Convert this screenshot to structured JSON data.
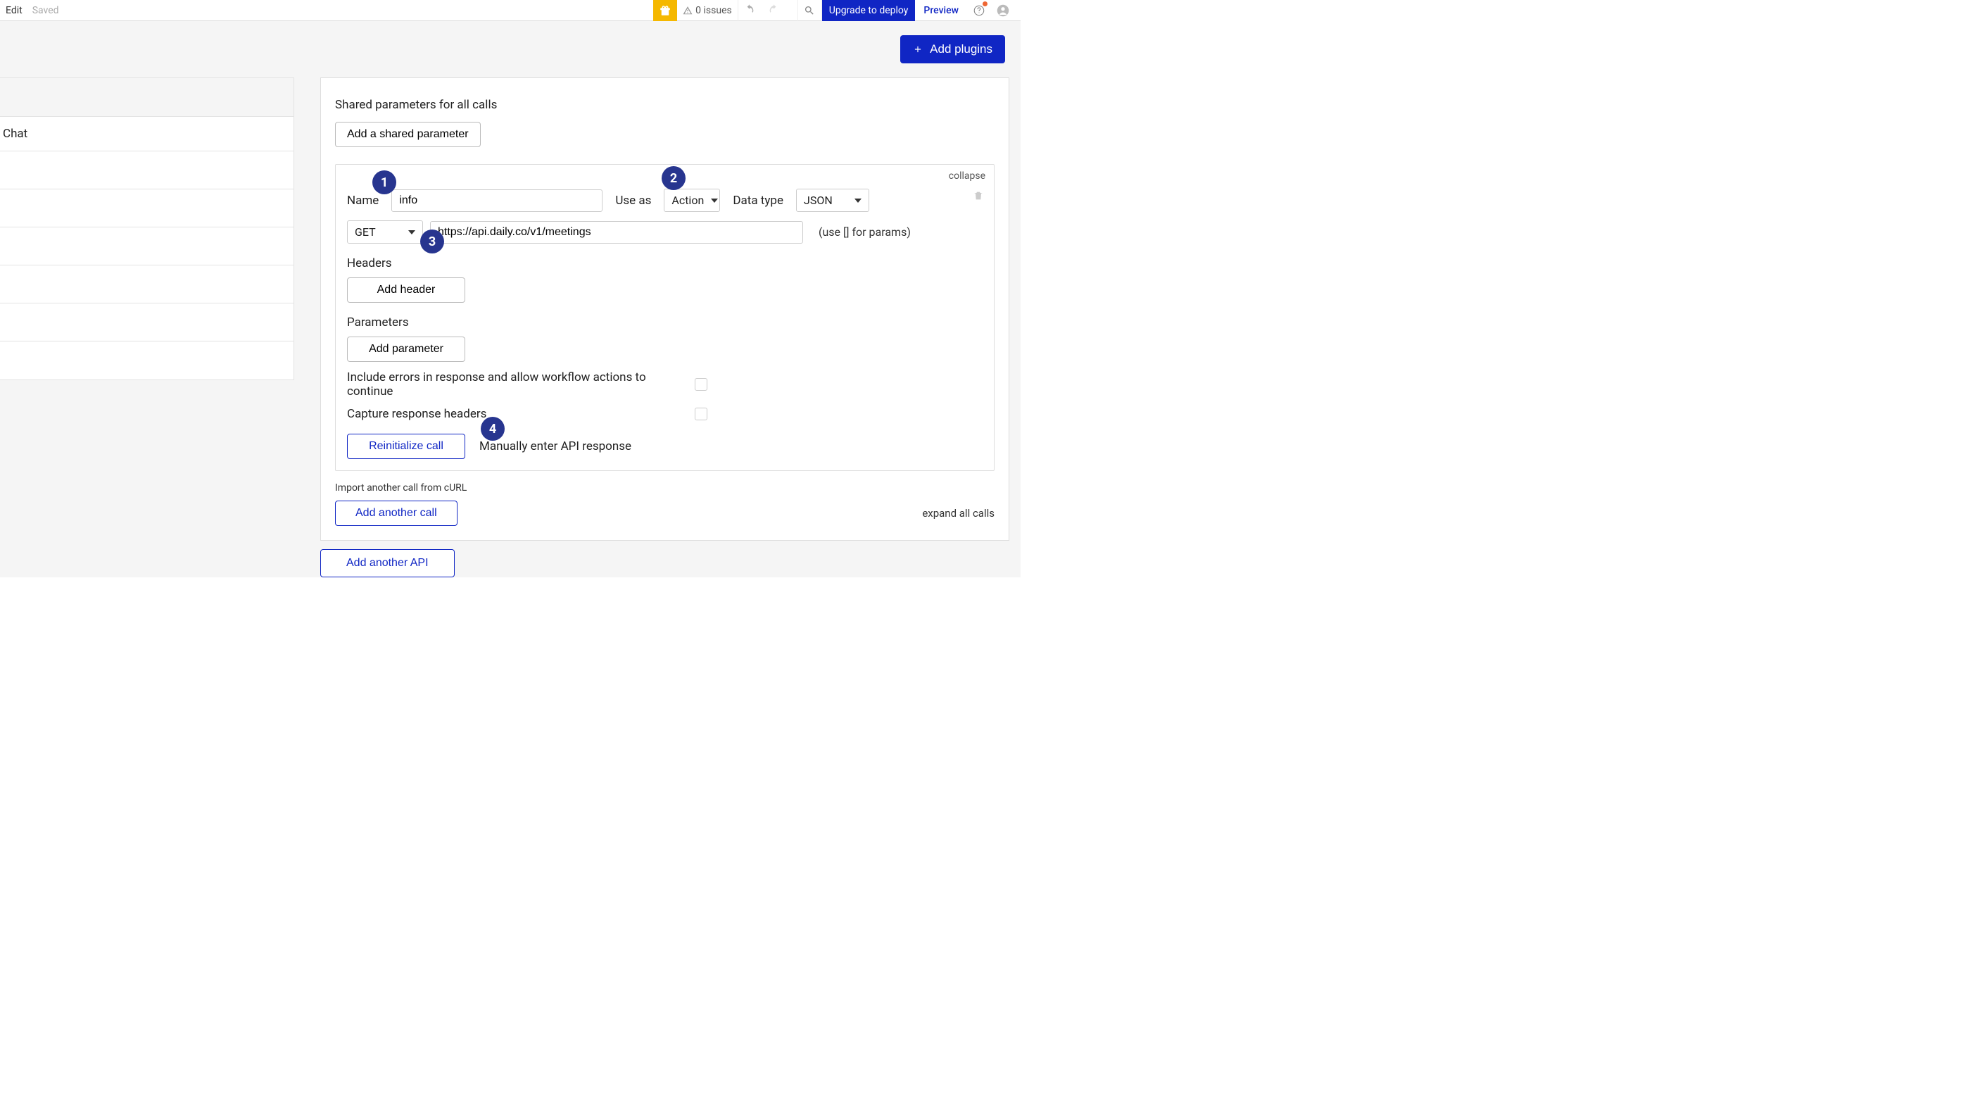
{
  "topbar": {
    "edit": "Edit",
    "saved": "Saved",
    "issues_count": "0 issues",
    "upgrade": "Upgrade to deploy",
    "preview": "Preview"
  },
  "add_plugins": "Add plugins",
  "sidebar": {
    "item_chat": "Chat"
  },
  "panel": {
    "shared_params_label": "Shared parameters for all calls",
    "add_shared_param": "Add a shared parameter",
    "collapse": "collapse",
    "name_label": "Name",
    "name_value": "info",
    "use_as_label": "Use as",
    "use_as_value": "Action",
    "data_type_label": "Data type",
    "data_type_value": "JSON",
    "method": "GET",
    "url": "https://api.daily.co/v1/meetings",
    "params_hint": "(use [] for params)",
    "headers_label": "Headers",
    "add_header": "Add header",
    "parameters_label": "Parameters",
    "add_parameter": "Add parameter",
    "include_errors": "Include errors in response and allow workflow actions to continue",
    "capture_headers": "Capture response headers",
    "reinitialize": "Reinitialize call",
    "manual_response": "Manually enter API response",
    "import_curl": "Import another call from cURL",
    "add_another_call": "Add another call",
    "expand_all": "expand all calls"
  },
  "add_another_api": "Add another API",
  "badges": {
    "b1": "1",
    "b2": "2",
    "b3": "3",
    "b4": "4"
  }
}
